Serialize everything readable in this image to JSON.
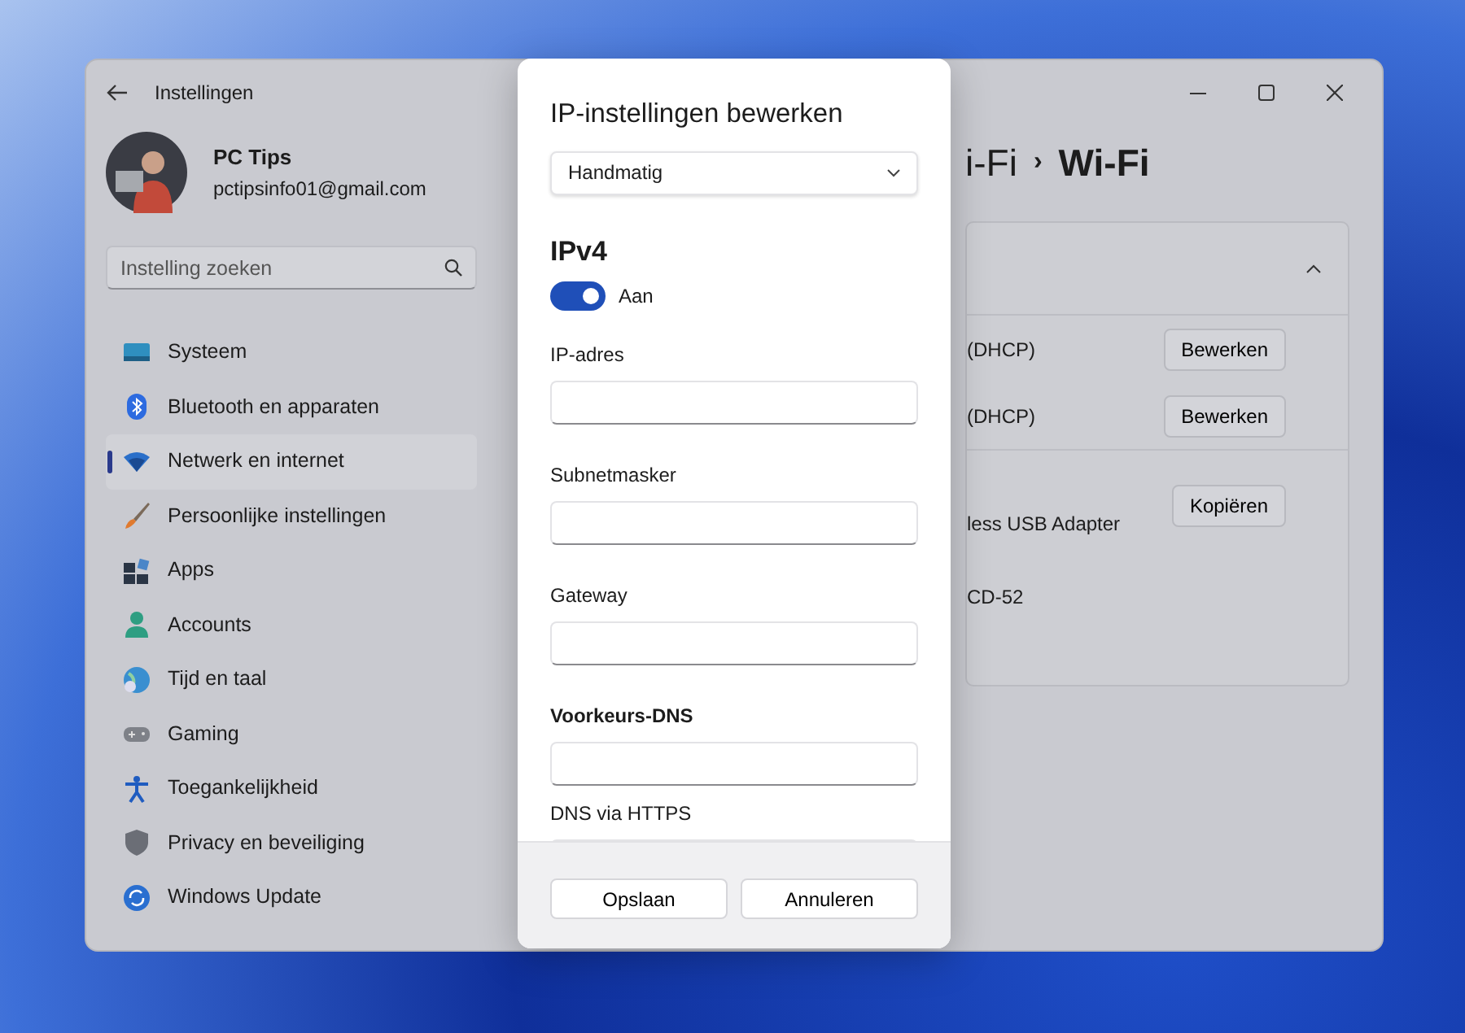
{
  "window": {
    "title": "Instellingen"
  },
  "account": {
    "name": "PC Tips",
    "email": "pctipsinfo01@gmail.com"
  },
  "search": {
    "placeholder": "Instelling zoeken"
  },
  "sidebar": {
    "items": [
      {
        "label": "Systeem",
        "selected": false
      },
      {
        "label": "Bluetooth en apparaten",
        "selected": false
      },
      {
        "label": "Netwerk en internet",
        "selected": true
      },
      {
        "label": "Persoonlijke instellingen",
        "selected": false
      },
      {
        "label": "Apps",
        "selected": false
      },
      {
        "label": "Accounts",
        "selected": false
      },
      {
        "label": "Tijd en taal",
        "selected": false
      },
      {
        "label": "Gaming",
        "selected": false
      },
      {
        "label": "Toegankelijkheid",
        "selected": false
      },
      {
        "label": "Privacy en beveiliging",
        "selected": false
      },
      {
        "label": "Windows Update",
        "selected": false
      }
    ]
  },
  "breadcrumb": {
    "parent": "i-Fi",
    "separator": "›",
    "current": "Wi-Fi"
  },
  "panel": {
    "expanded": true,
    "rows": [
      {
        "text": "(DHCP)",
        "button": "Bewerken"
      },
      {
        "text": "(DHCP)",
        "button": "Bewerken"
      },
      {
        "text": "less USB Adapter",
        "button": "Kopiëren"
      },
      {
        "text": "CD-52"
      }
    ]
  },
  "dialog": {
    "title": "IP-instellingen bewerken",
    "mode": {
      "value": "Handmatig"
    },
    "section": "IPv4",
    "toggle": {
      "on": true,
      "label": "Aan"
    },
    "fields": [
      {
        "label": "IP-adres",
        "bold": false
      },
      {
        "label": "Subnetmasker",
        "bold": false
      },
      {
        "label": "Gateway",
        "bold": false
      },
      {
        "label": "Voorkeurs-DNS",
        "bold": true
      },
      {
        "label": "DNS via HTTPS",
        "bold": false
      }
    ],
    "buttons": [
      "Opslaan",
      "Annuleren"
    ]
  }
}
